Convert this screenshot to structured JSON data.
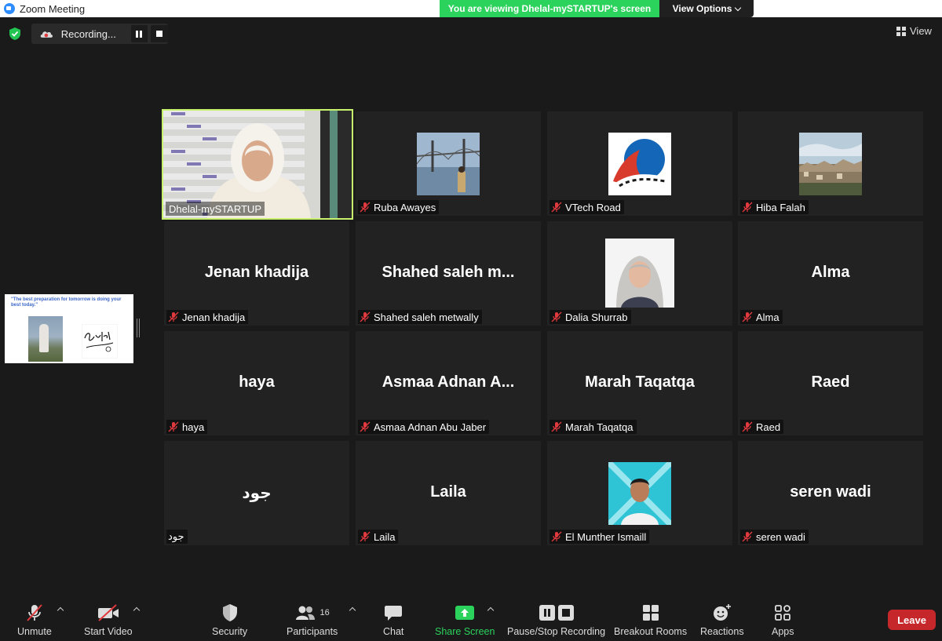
{
  "window": {
    "title": "Zoom Meeting"
  },
  "share_banner": {
    "text": "You are viewing Dhelal-mySTARTUP's screen",
    "view_options": "View Options"
  },
  "recording": {
    "label": "Recording..."
  },
  "view": {
    "label": "View"
  },
  "thumbnail": {
    "quote": "\"The best preparation for tomorrow is doing your best today.\"",
    "sign_text": "Good Luck!"
  },
  "participants": [
    {
      "name": "Dhelal-mySTARTUP",
      "display": "",
      "muted": false,
      "video": true,
      "active": true
    },
    {
      "name": "Ruba Awayes",
      "display": "",
      "muted": true,
      "avatar": "bridge-photo"
    },
    {
      "name": "VTech Road",
      "display": "",
      "muted": true,
      "avatar": "vtech-logo"
    },
    {
      "name": "Hiba Falah",
      "display": "",
      "muted": true,
      "avatar": "city-photo"
    },
    {
      "name": "Jenan khadija",
      "display": "Jenan khadija",
      "muted": true
    },
    {
      "name": "Shahed saleh metwally",
      "display": "Shahed saleh m...",
      "muted": true
    },
    {
      "name": "Dalia Shurrab",
      "display": "",
      "muted": true,
      "avatar": "portrait-photo"
    },
    {
      "name": "Alma",
      "display": "Alma",
      "muted": true
    },
    {
      "name": "haya",
      "display": "haya",
      "muted": true
    },
    {
      "name": "Asmaa Adnan Abu Jaber",
      "display": "Asmaa Adnan A...",
      "muted": true
    },
    {
      "name": "Marah Taqatqa",
      "display": "Marah Taqatqa",
      "muted": true
    },
    {
      "name": "Raed",
      "display": "Raed",
      "muted": true
    },
    {
      "name": "جود",
      "display": "جود",
      "muted": false
    },
    {
      "name": "Laila",
      "display": "Laila",
      "muted": true
    },
    {
      "name": "El Munther Ismaill",
      "display": "",
      "muted": true,
      "avatar": "man-photo"
    },
    {
      "name": "seren wadi",
      "display": "seren wadi",
      "muted": true
    }
  ],
  "toolbar": {
    "unmute": "Unmute",
    "start_video": "Start Video",
    "security": "Security",
    "participants": "Participants",
    "participants_count": "16",
    "chat": "Chat",
    "share_screen": "Share Screen",
    "pause_stop_recording": "Pause/Stop Recording",
    "breakout_rooms": "Breakout Rooms",
    "reactions": "Reactions",
    "apps": "Apps",
    "leave": "Leave"
  },
  "colors": {
    "share_green": "#2bd25c",
    "active_border": "#c8f26e",
    "leave_red": "#c6272a",
    "mute_red": "#e0393e"
  }
}
